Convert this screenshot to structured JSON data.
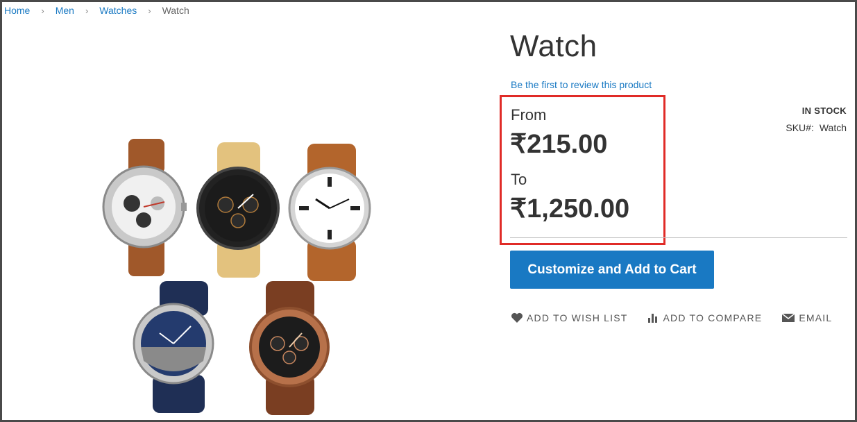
{
  "breadcrumb": {
    "items": [
      {
        "label": "Home",
        "link": true
      },
      {
        "label": "Men",
        "link": true
      },
      {
        "label": "Watches",
        "link": true
      },
      {
        "label": "Watch",
        "link": false
      }
    ],
    "separator": "›"
  },
  "product": {
    "title": "Watch",
    "review_link": "Be the first to review this product",
    "price": {
      "from_label": "From",
      "from_value": "₹215.00",
      "to_label": "To",
      "to_value": "₹1,250.00"
    },
    "stock_status": "IN STOCK",
    "sku_label": "SKU#:",
    "sku_value": "Watch",
    "add_to_cart": "Customize and Add to Cart",
    "actions": {
      "wishlist": "ADD TO WISH LIST",
      "compare": "ADD TO COMPARE",
      "email": "EMAIL"
    }
  },
  "colors": {
    "accent": "#1979c3",
    "highlight_border": "#e02b27",
    "text": "#333333"
  },
  "icons": {
    "wishlist": "heart-icon",
    "compare": "bar-chart-icon",
    "email": "envelope-icon"
  }
}
